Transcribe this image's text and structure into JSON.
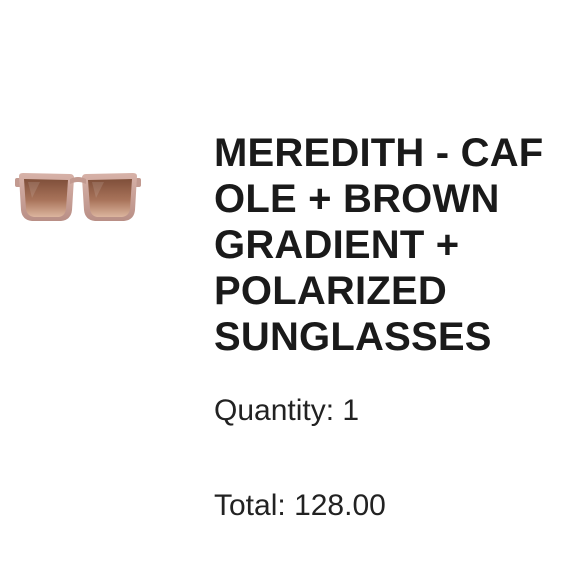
{
  "product": {
    "title_lines": [
      "MEREDITH - CAF",
      "OLE + BROWN",
      "GRADIENT +",
      "POLARIZED",
      "SUNGLASSES"
    ],
    "thumbnail_icon": "sunglasses-icon",
    "frame_color": "#c9a39a",
    "lens_color_top": "#8a5a45",
    "lens_color_bottom": "#d9b29a"
  },
  "quantity": {
    "label": "Quantity:",
    "value": "1"
  },
  "total": {
    "label": "Total:",
    "value": "128.00"
  }
}
